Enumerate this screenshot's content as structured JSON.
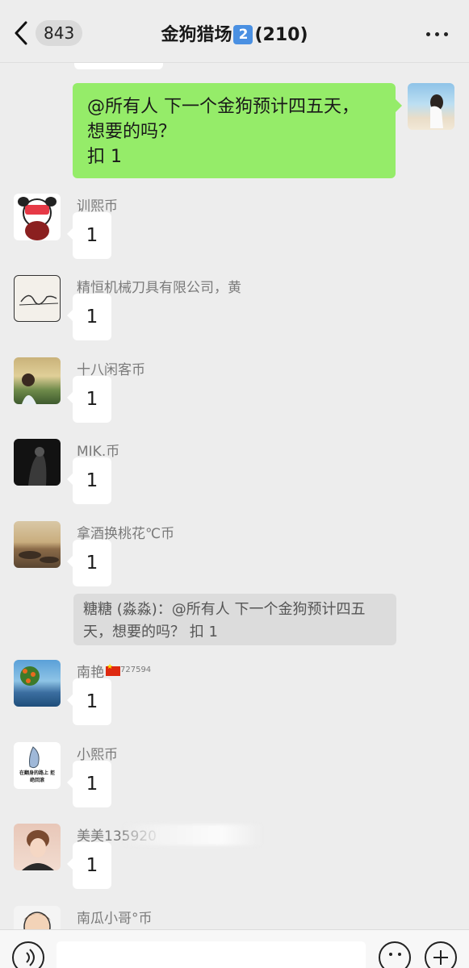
{
  "header": {
    "unread_count": "843",
    "title_prefix": "金狗猎场",
    "title_keycap": "2",
    "title_suffix": "(210)"
  },
  "my_message": {
    "line1": "@所有人  下一个金狗预计四五天，",
    "line2": "想要的吗？",
    "line3": "扣 1"
  },
  "messages": [
    {
      "sender": "训熙币",
      "text": "1"
    },
    {
      "sender": "精恒机械刀具有限公司，黄",
      "text": "1"
    },
    {
      "sender": "十八闲客币",
      "text": "1"
    },
    {
      "sender": "MIK.币",
      "text": "1"
    },
    {
      "sender": "拿酒换桃花℃币",
      "text": "1"
    },
    {
      "sender": "南艳",
      "sender_suffix": "727594",
      "text": "1"
    },
    {
      "sender": "小熙币",
      "text": "1"
    },
    {
      "sender": "美美135920",
      "text": "1"
    },
    {
      "sender": "南瓜小哥°币",
      "text": ""
    }
  ],
  "quote": {
    "text": "糖糖 (淼淼)：@所有人 下一个金狗预计四五天，想要的吗？ 扣 1"
  },
  "avatar6_caption": "在翻身的路上 拒绝回滚",
  "colors": {
    "background": "#ededed",
    "my_bubble": "#95ec69",
    "other_bubble": "#ffffff",
    "quote_bg": "#dcdcdc"
  },
  "icons": [
    "back-chevron-icon",
    "more-dots-icon",
    "voice-icon",
    "emoji-icon",
    "plus-icon"
  ]
}
